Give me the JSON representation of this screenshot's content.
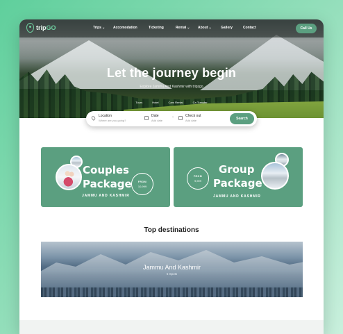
{
  "brand": {
    "name_prefix": "trip",
    "name_suffix": "GO"
  },
  "nav": {
    "items": [
      {
        "label": "Trips",
        "has_dropdown": true
      },
      {
        "label": "Accomodation",
        "has_dropdown": false
      },
      {
        "label": "Ticketing",
        "has_dropdown": false
      },
      {
        "label": "Rental",
        "has_dropdown": true
      },
      {
        "label": "About",
        "has_dropdown": true
      },
      {
        "label": "Gallery",
        "has_dropdown": false
      },
      {
        "label": "Contact",
        "has_dropdown": false
      }
    ],
    "chevron": "⌄",
    "call_label": "Call Us"
  },
  "hero": {
    "title": "Let the journey begin",
    "subtitle": "Explore Jammu And Kashmir with tripzgo",
    "tabs": [
      "Tours",
      "Hotel",
      "Cars Rental",
      "Ca Transfer"
    ]
  },
  "search": {
    "location_label": "Location",
    "location_placeholder": "Where are you going?",
    "date_label": "Date",
    "date_placeholder": "Add date",
    "checkout_label": "Check out",
    "checkout_placeholder": "Add date",
    "button_label": "Search"
  },
  "packages": [
    {
      "title_line1": "Couples",
      "title_line2": "Package",
      "region": "JAMMU AND KASHMIR",
      "from_label": "FROM",
      "price": "10,999"
    },
    {
      "title_line1": "Group",
      "title_line2": "Package",
      "region": "JAMMU AND KASHMIR",
      "from_label": "FROM",
      "price": "9,599"
    }
  ],
  "destinations": {
    "heading": "Top destinations",
    "items": [
      {
        "name": "Jammu And Kashmir",
        "count": "5 Spots"
      }
    ]
  },
  "colors": {
    "accent": "#5b9f80",
    "brand_green": "#6fd0a0",
    "background": "#5fcf9c"
  },
  "icons": [
    "location-pin-icon",
    "calendar-icon",
    "chevron-down-icon"
  ]
}
